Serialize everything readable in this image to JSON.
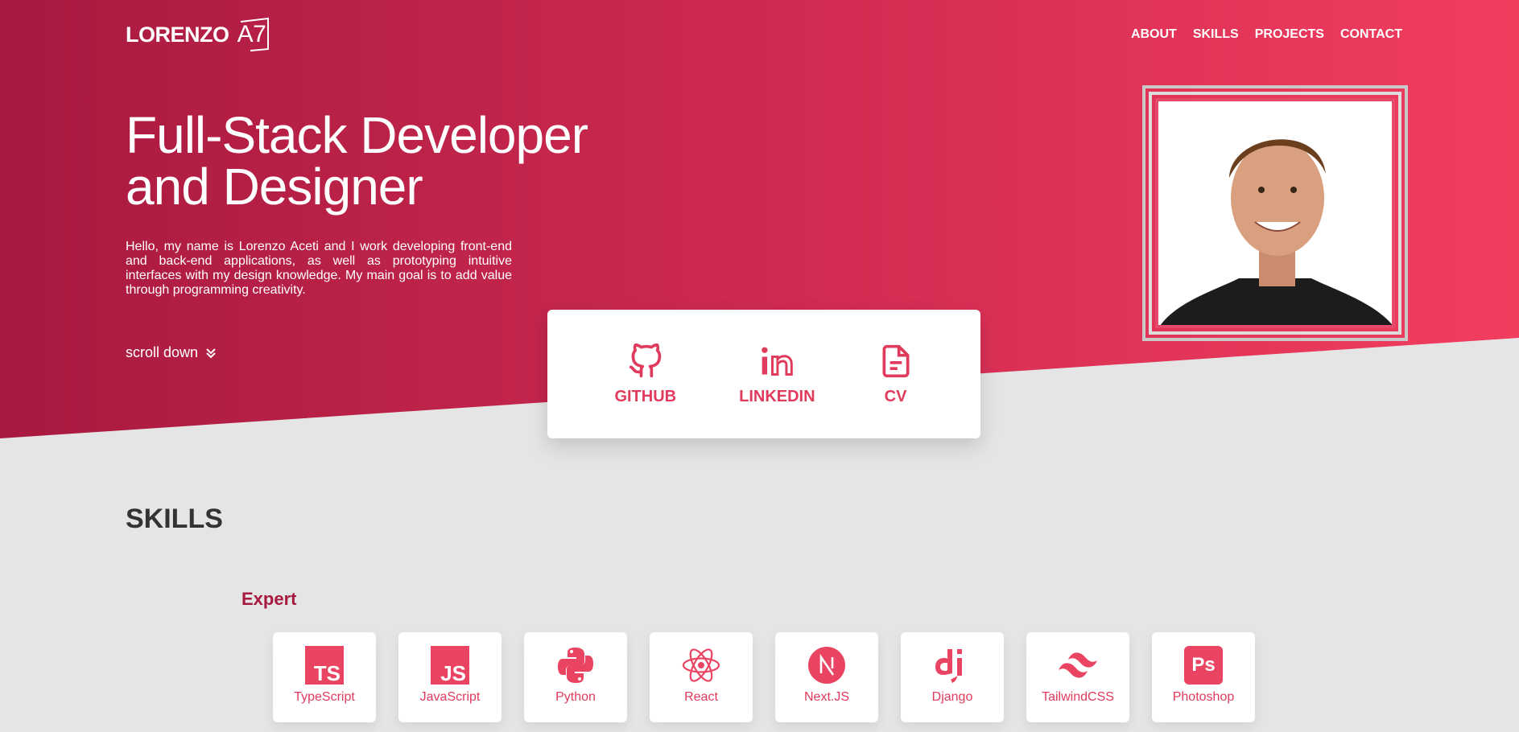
{
  "navbar": {
    "logo_text": "LORENZO",
    "logo_mark": "A7",
    "links": [
      "ABOUT",
      "SKILLS",
      "PROJECTS",
      "CONTACT"
    ]
  },
  "hero": {
    "title_line1": "Full-Stack Developer",
    "title_line2": "and Designer",
    "description": "Hello, my name is Lorenzo Aceti and I work developing front-end and back-end applications, as well as prototyping intuitive interfaces with my design knowledge. My main goal is to add value through programming creativity.",
    "scroll_label": "scroll down"
  },
  "social": [
    {
      "label": "GITHUB",
      "icon": "github-icon"
    },
    {
      "label": "LINKEDIN",
      "icon": "linkedin-icon"
    },
    {
      "label": "CV",
      "icon": "document-icon"
    }
  ],
  "skills": {
    "title": "SKILLS",
    "expert_title": "Expert",
    "items": [
      {
        "label": "TypeScript",
        "icon": "typescript-icon"
      },
      {
        "label": "JavaScript",
        "icon": "javascript-icon"
      },
      {
        "label": "Python",
        "icon": "python-icon"
      },
      {
        "label": "React",
        "icon": "react-icon"
      },
      {
        "label": "Next.JS",
        "icon": "nextjs-icon"
      },
      {
        "label": "Django",
        "icon": "django-icon"
      },
      {
        "label": "TailwindCSS",
        "icon": "tailwind-icon"
      },
      {
        "label": "Photoshop",
        "icon": "photoshop-icon"
      }
    ]
  },
  "colors": {
    "accent": "#e03a5c",
    "hero_start": "#a8193f",
    "hero_end": "#f23d5f",
    "background": "#e5e5e5"
  }
}
